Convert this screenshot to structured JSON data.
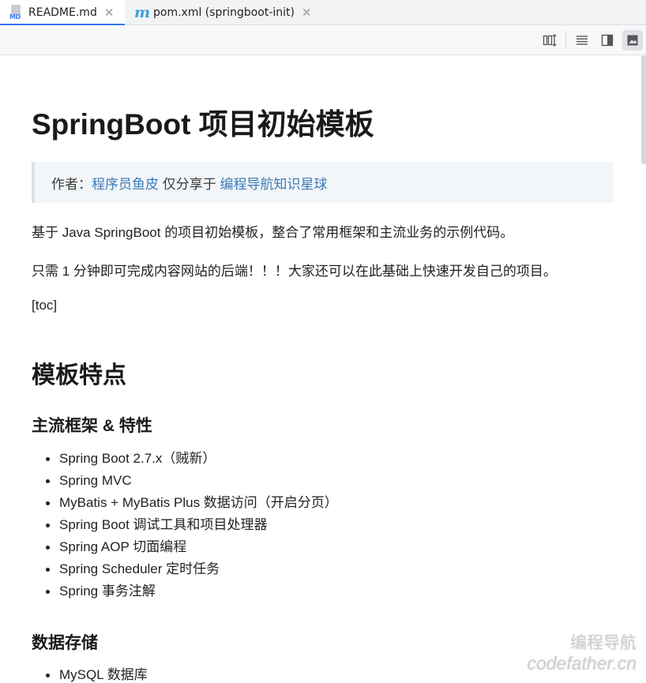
{
  "tabs": [
    {
      "label": "README.md",
      "active": true,
      "icon": "markdown-file-icon"
    },
    {
      "label": "pom.xml (springboot-init)",
      "active": false,
      "icon": "maven-m-icon"
    }
  ],
  "toolbar": {
    "buttons": [
      "editor-only-sync-icon",
      "editor-only-icon",
      "editor-and-preview-icon",
      "preview-only-icon"
    ],
    "selected": "preview-only-icon"
  },
  "doc": {
    "title": "SpringBoot 项目初始模板",
    "quote": {
      "prefix": "作者：",
      "author_link": "程序员鱼皮",
      "middle": " 仅分享于 ",
      "site_link": "编程导航知识星球"
    },
    "intro": "基于 Java SpringBoot 的项目初始模板，整合了常用框架和主流业务的示例代码。",
    "tagline": "只需 1 分钟即可完成内容网站的后端！！！大家还可以在此基础上快速开发自己的项目。",
    "toc": "[toc]",
    "section_features": "模板特点",
    "sub_frameworks": "主流框架 & 特性",
    "frameworks": [
      "Spring Boot 2.7.x（贼新）",
      "Spring MVC",
      "MyBatis + MyBatis Plus 数据访问（开启分页）",
      "Spring Boot 调试工具和项目处理器",
      "Spring AOP 切面编程",
      "Spring Scheduler 定时任务",
      "Spring 事务注解"
    ],
    "sub_storage": "数据存储",
    "storage": [
      "MySQL 数据库"
    ]
  },
  "watermark": {
    "line1": "编程导航",
    "line2": "codefather.cn"
  },
  "colors": {
    "accent": "#3574f0",
    "link": "#3a79b8",
    "quote_bg": "#f3f6f9"
  }
}
